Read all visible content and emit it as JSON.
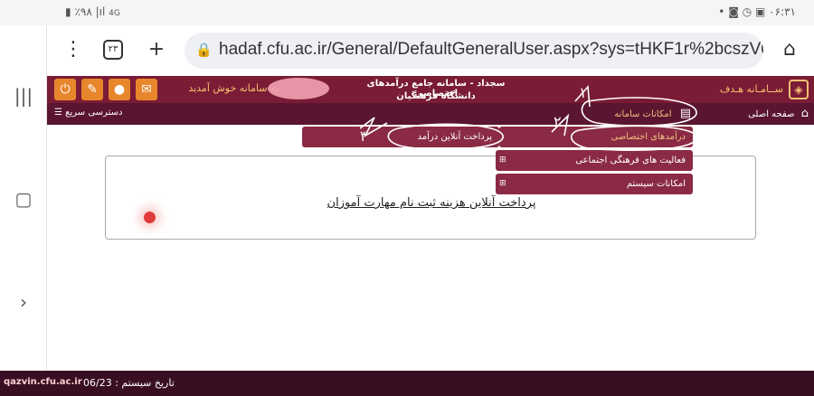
{
  "status_bar": {
    "battery": "٪۹۸",
    "network": "4G",
    "time": "۰۶:۳۱",
    "icons": [
      "battery-icon",
      "signal-icon",
      "instagram-icon",
      "clock-icon",
      "gallery-icon",
      "notification-dot-icon"
    ]
  },
  "nav_rail": {
    "icons": [
      "recent-apps-icon",
      "home-icon",
      "back-icon"
    ]
  },
  "browser": {
    "tab_count": "۲۳",
    "url": "hadaf.cfu.ac.ir/General/DefaultGeneralUser.aspx?sys=tHKF1r%2bcszV0g",
    "icons": [
      "menu-dots-icon",
      "tabs-icon",
      "new-tab-plus-icon",
      "lock-icon",
      "home-icon"
    ]
  },
  "header": {
    "welcome": "به سامانه خوش آمدید",
    "title_line1": "سجداد - سامانه جامع درآمدهای اختصاصی",
    "title_line2": "دانشگاه فرهنگیان",
    "brand": "ســامـانه هـدف",
    "buttons": [
      "power-icon",
      "user-edit-icon",
      "user-icon",
      "mail-icon"
    ]
  },
  "menu": {
    "quick_access": "دسترسی سریع",
    "home": "صفحه اصلی",
    "system_features": "امکانات سامانه"
  },
  "dropdown": {
    "special_revenue": "درآمدهای اختصاصی",
    "online_payment": "پرداخت آنلاین درآمد",
    "cultural_activities": "فعالیت های فرهنگی اجتماعی",
    "system_options": "امکانات سیستم"
  },
  "content": {
    "payment_link": "پرداخت آنلاین هزینه ثبت نام مهارت آموزان"
  },
  "footer": {
    "system_date_label": "تاریخ سیستم :",
    "system_date_value": "06/23",
    "watermark": "qazvin.cfu.ac.ir"
  },
  "annotations": {
    "numbers": [
      "۱",
      "۲",
      "۳"
    ]
  },
  "colors": {
    "header": "#7a1c36",
    "menubar": "#5a1530",
    "dropdown": "#8a2a44",
    "accent_orange": "#e8862c",
    "brand_gold": "#f6c070",
    "footer": "#3a0e22"
  }
}
